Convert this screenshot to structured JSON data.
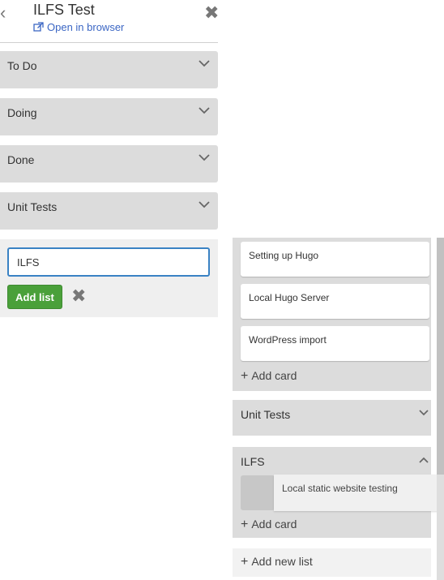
{
  "header": {
    "back_icon": "chevron-left-icon",
    "title": "ILFS Test",
    "open_link": "Open in browser",
    "close_icon": "close-icon"
  },
  "lists": [
    {
      "label": "To Do"
    },
    {
      "label": "Doing"
    },
    {
      "label": "Done"
    },
    {
      "label": "Unit Tests"
    }
  ],
  "add_list": {
    "input_value": "ILFS",
    "button_label": "Add list"
  },
  "right_panel": {
    "cards": [
      {
        "label": "Setting up Hugo"
      },
      {
        "label": "Local Hugo Server"
      },
      {
        "label": "WordPress import"
      }
    ],
    "add_card_label": "Add card",
    "unit_tests_label": "Unit Tests",
    "ilfs_label": "ILFS",
    "dragging_card_label": "Local static website testing",
    "add_card_label_2": "Add card",
    "add_new_list_label": "Add new list"
  },
  "colors": {
    "accent_blue": "#3a82c4",
    "link_blue": "#3b66c4",
    "button_green": "#4aa03a",
    "list_gray": "#dcdcdc"
  }
}
